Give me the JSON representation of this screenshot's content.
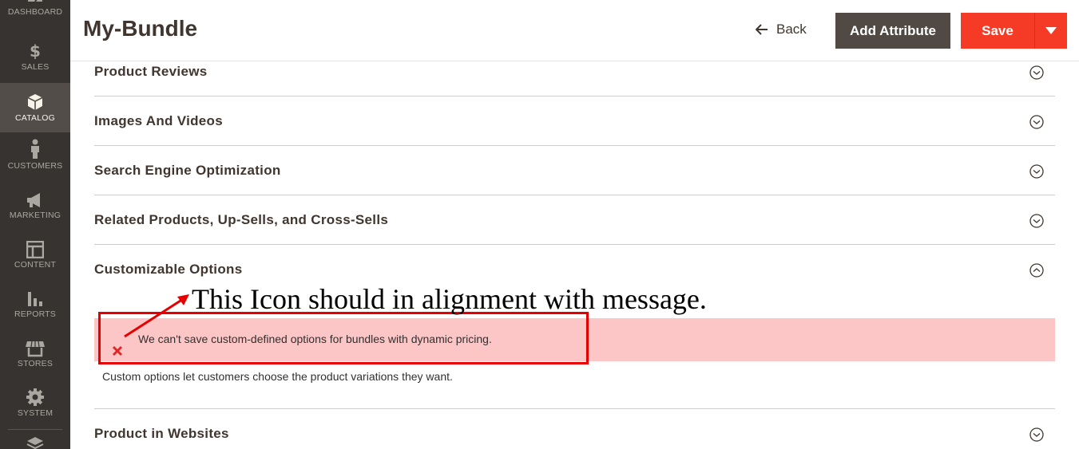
{
  "sidebar": {
    "items": [
      {
        "label": "DASHBOARD",
        "icon": "dashboard-icon"
      },
      {
        "label": "SALES",
        "icon": "dollar-icon"
      },
      {
        "label": "CATALOG",
        "icon": "box-icon",
        "active": true
      },
      {
        "label": "CUSTOMERS",
        "icon": "person-icon"
      },
      {
        "label": "MARKETING",
        "icon": "megaphone-icon"
      },
      {
        "label": "CONTENT",
        "icon": "layout-icon"
      },
      {
        "label": "REPORTS",
        "icon": "bar-chart-icon"
      },
      {
        "label": "STORES",
        "icon": "store-icon"
      },
      {
        "label": "SYSTEM",
        "icon": "gear-icon"
      }
    ]
  },
  "header": {
    "title": "My-Bundle",
    "back_label": "Back",
    "add_attribute_label": "Add Attribute",
    "save_label": "Save"
  },
  "sections": [
    {
      "title": "Product Reviews",
      "state": "collapsed"
    },
    {
      "title": "Images And Videos",
      "state": "collapsed"
    },
    {
      "title": "Search Engine Optimization",
      "state": "collapsed"
    },
    {
      "title": "Related Products, Up-Sells, and Cross-Sells",
      "state": "collapsed"
    },
    {
      "title": "Customizable Options",
      "state": "expanded"
    },
    {
      "title": "Product in Websites",
      "state": "collapsed"
    }
  ],
  "customizable_options": {
    "error_message": "We can't save custom-defined options for bundles with dynamic pricing.",
    "helper_text": "Custom options let customers choose the product variations they want."
  },
  "annotation": {
    "text": "This Icon should in alignment with message."
  },
  "colors": {
    "sidebar_bg": "#373330",
    "save_button": "#f53b26",
    "add_attribute_button": "#514943",
    "error_bg": "#fdc6c6",
    "annotation_red": "#e60000"
  }
}
